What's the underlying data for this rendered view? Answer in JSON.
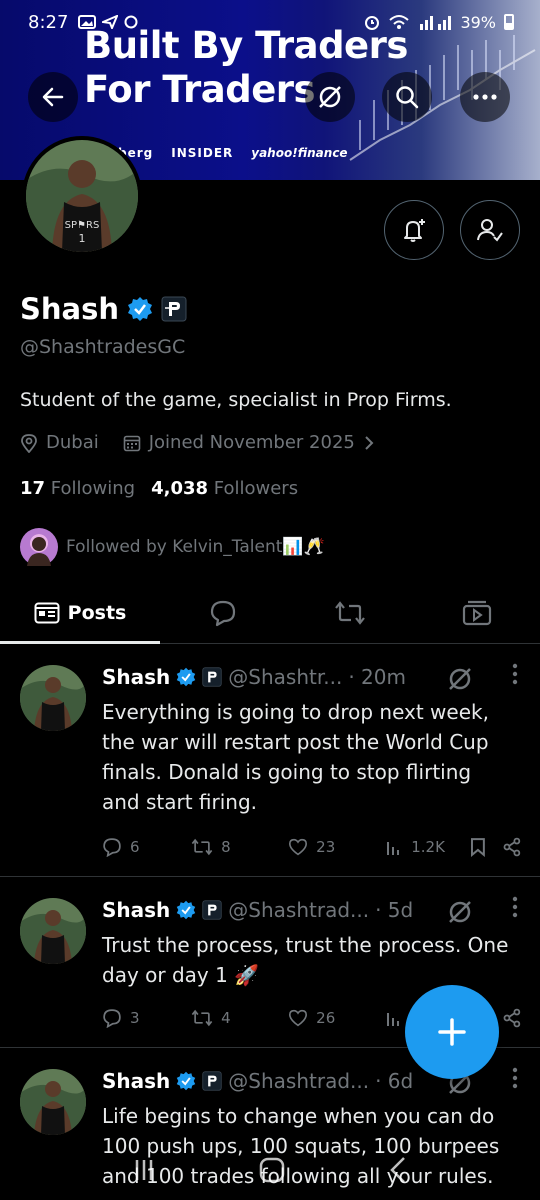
{
  "status_bar": {
    "time": "8:27",
    "battery": "39%"
  },
  "banner": {
    "headline_line1": "Built By Traders",
    "headline_line2": "For Traders",
    "logos": [
      "berg",
      "INSIDER",
      "yahoo!finance"
    ]
  },
  "profile": {
    "display_name": "Shash",
    "handle": "@ShashtradesGC",
    "bio": "Student of the game, specialist in Prop Firms.",
    "location": "Dubai",
    "joined": "Joined November 2025",
    "following_count": "17",
    "following_label": "Following",
    "followers_count": "4,038",
    "followers_label": "Followers",
    "followed_by": "Followed by Kelvin_Talent📊🥂"
  },
  "tabs": {
    "posts_label": "Posts"
  },
  "posts": [
    {
      "name": "Shash",
      "handle": "@Shashtr...",
      "time": "· 20m",
      "text": "Everything is going to drop next week, the war will restart post the World Cup finals. Donald is going to stop flirting and start firing.",
      "replies": "6",
      "reposts": "8",
      "likes": "23",
      "views": "1.2K"
    },
    {
      "name": "Shash",
      "handle": "@Shashtrad...",
      "time": "· 5d",
      "text": "Trust the process, trust the process. One day or day 1 🚀",
      "replies": "3",
      "reposts": "4",
      "likes": "26",
      "views": ""
    },
    {
      "name": "Shash",
      "handle": "@Shashtrad...",
      "time": "· 6d",
      "text": "Life begins to change when you can do 100 push ups, 100 squats, 100 burpees and 100 trades following all your rules.",
      "replies": "",
      "reposts": "",
      "likes": "",
      "views": ""
    }
  ],
  "colors": {
    "accent": "#1d9bf0",
    "verified": "#1d9bf0",
    "muted": "#71767b",
    "divider": "#2f3336"
  },
  "icons": [
    "back-arrow-icon",
    "grok-slash-icon",
    "search-icon",
    "more-icon",
    "bell-plus-icon",
    "person-check-icon",
    "location-icon",
    "calendar-icon",
    "chevron-right-icon",
    "verified-badge-icon",
    "affiliate-badge-icon",
    "posts-tab-icon",
    "replies-tab-icon",
    "reposts-tab-icon",
    "media-tab-icon",
    "reply-icon",
    "repost-icon",
    "like-icon",
    "views-icon",
    "bookmark-icon",
    "share-icon",
    "compose-plus-icon"
  ]
}
